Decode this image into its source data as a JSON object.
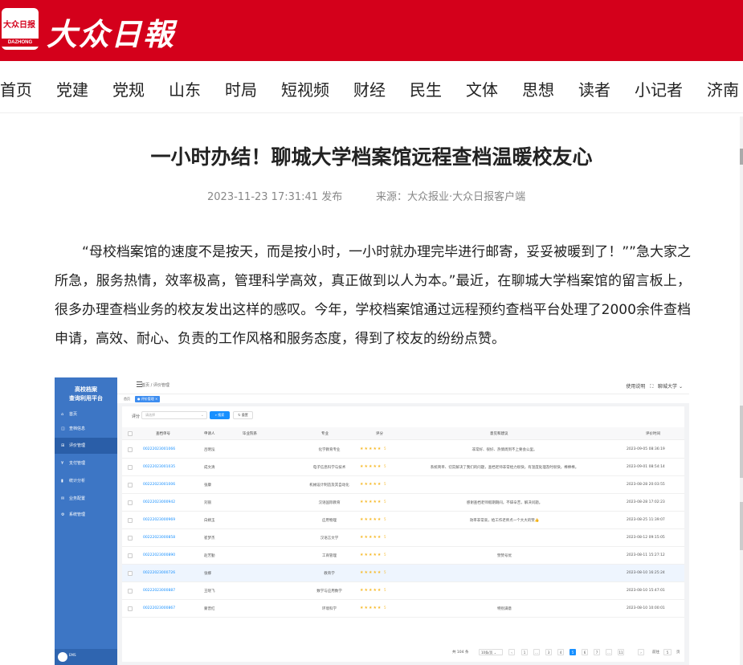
{
  "header": {
    "logo_cn": "大众日报",
    "logo_en": "DAZHONG",
    "brand_text": "大众日報"
  },
  "nav": [
    "首页",
    "党建",
    "党规",
    "山东",
    "时局",
    "短视频",
    "财经",
    "民生",
    "文体",
    "思想",
    "读者",
    "小记者",
    "济南"
  ],
  "article": {
    "title": "一小时办结！聊城大学档案馆远程查档温暖校友心",
    "date": "2023-11-23 17:31:41 发布",
    "source": "来源：大众报业·大众日报客户端",
    "paragraph": "“母校档案馆的速度不是按天，而是按小时，一小时就办理完毕进行邮寄，妥妥被暖到了！””急大家之所急，服务热情，效率极高，管理科学高效，真正做到以人为本。”最近，在聊城大学档案馆的留言板上，很多办理查档业务的校友发出这样的感叹。今年，学校档案馆通过远程预约查档平台处理了2000余件查档申请，高效、耐心、负责的工作风格和服务态度，得到了校友的纷纷点赞。"
  },
  "screenshot": {
    "sidebar": {
      "title_line1": "高校档案",
      "title_line2": "查询利用平台",
      "items": [
        {
          "icon": "⌂",
          "label": "首页",
          "icon_name": "home-icon"
        },
        {
          "icon": "◫",
          "label": "查档信息",
          "icon_name": "document-icon"
        },
        {
          "icon": "⊞",
          "label": "评价管理",
          "icon_name": "grid-icon",
          "active": true
        },
        {
          "icon": "¥",
          "label": "支付管理",
          "icon_name": "yuan-icon"
        },
        {
          "icon": "▮",
          "label": "统计分析",
          "icon_name": "bar-chart-icon"
        },
        {
          "icon": "✉",
          "label": "业务配置",
          "icon_name": "mail-icon"
        },
        {
          "icon": "⚙",
          "label": "系统管理",
          "icon_name": "gear-icon"
        }
      ],
      "footer_logo_text": "EMS"
    },
    "topbar": {
      "breadcrumb": "首页  /  评价管理",
      "help": "使用说明",
      "user": "聊城大学"
    },
    "tabs": {
      "home": "首页",
      "active": "评价管理"
    },
    "filter": {
      "label": "评分",
      "placeholder": "请选择",
      "search_label": "搜索",
      "reset_label": "重置"
    },
    "table": {
      "headers": [
        "查档单号",
        "申请人",
        "毕业院系",
        "专业",
        "评分",
        "意见和建议",
        "评价时间"
      ],
      "rows": [
        {
          "no": "00222023001066",
          "name": "吕明泓",
          "dept": "",
          "major": "化学教育专业",
          "score": "5",
          "comment": "非常好、很好、热情周到不上要会公里。",
          "time": "2023-09-05 08:36:19"
        },
        {
          "no": "00222023001035",
          "name": "成文清",
          "dept": "",
          "major": "电子信息科学与技术",
          "score": "5",
          "comment": "系统简单、切实解决了我们的问题，查档老师非常给力很快，有温度处理及时很快，棒棒棒。",
          "time": "2023-09-01 08:54:14"
        },
        {
          "no": "00222023001006",
          "name": "张康",
          "dept": "",
          "major": "机械设计制造及其自动化",
          "score": "5",
          "comment": "",
          "time": "2023-08-28 20:03:55"
        },
        {
          "no": "00222023000942",
          "name": "刘丽",
          "dept": "",
          "major": "汉语国际教育",
          "score": "5",
          "comment": "感谢查档老师假期期间，不辞辛苦，解决问题。",
          "time": "2023-08-28 17:02:23"
        },
        {
          "no": "00222023000969",
          "name": "白婧玉",
          "dept": "",
          "major": "应用物理",
          "score": "5",
          "comment": "效率非常高，给工作老师点一个大大的赞👍",
          "time": "2023-08-25 11:39:07"
        },
        {
          "no": "00222023000858",
          "name": "崔梦杰",
          "dept": "",
          "major": "汉语言文学",
          "score": "5",
          "comment": "",
          "time": "2023-08-12 09:15:05"
        },
        {
          "no": "00222023000890",
          "name": "赵芳勤",
          "dept": "",
          "major": "工商管理",
          "score": "5",
          "comment": "赞赞号优",
          "time": "2023-08-11 15:27:12"
        },
        {
          "no": "00222023000726",
          "name": "张娜",
          "dept": "",
          "major": "教育学",
          "score": "5",
          "comment": "",
          "time": "2023-08-10 16:25:24",
          "highlight": true
        },
        {
          "no": "00222023000887",
          "name": "王晓飞",
          "dept": "",
          "major": "数学与应用数学",
          "score": "5",
          "comment": "",
          "time": "2023-08-10 15:47:01"
        },
        {
          "no": "00222023000867",
          "name": "蒙晋红",
          "dept": "",
          "major": "环境科学",
          "score": "5",
          "comment": "特别满意",
          "time": "2023-08-10 10:00:01"
        }
      ]
    },
    "pagination": {
      "total": "共 104 条",
      "page_size": "10条/页",
      "pages": [
        "1",
        "...",
        "3",
        "4",
        "5",
        "6",
        "7",
        "...",
        "11"
      ],
      "current": "5",
      "goto_label": "前往",
      "goto_value": "5",
      "goto_suffix": "页"
    }
  }
}
